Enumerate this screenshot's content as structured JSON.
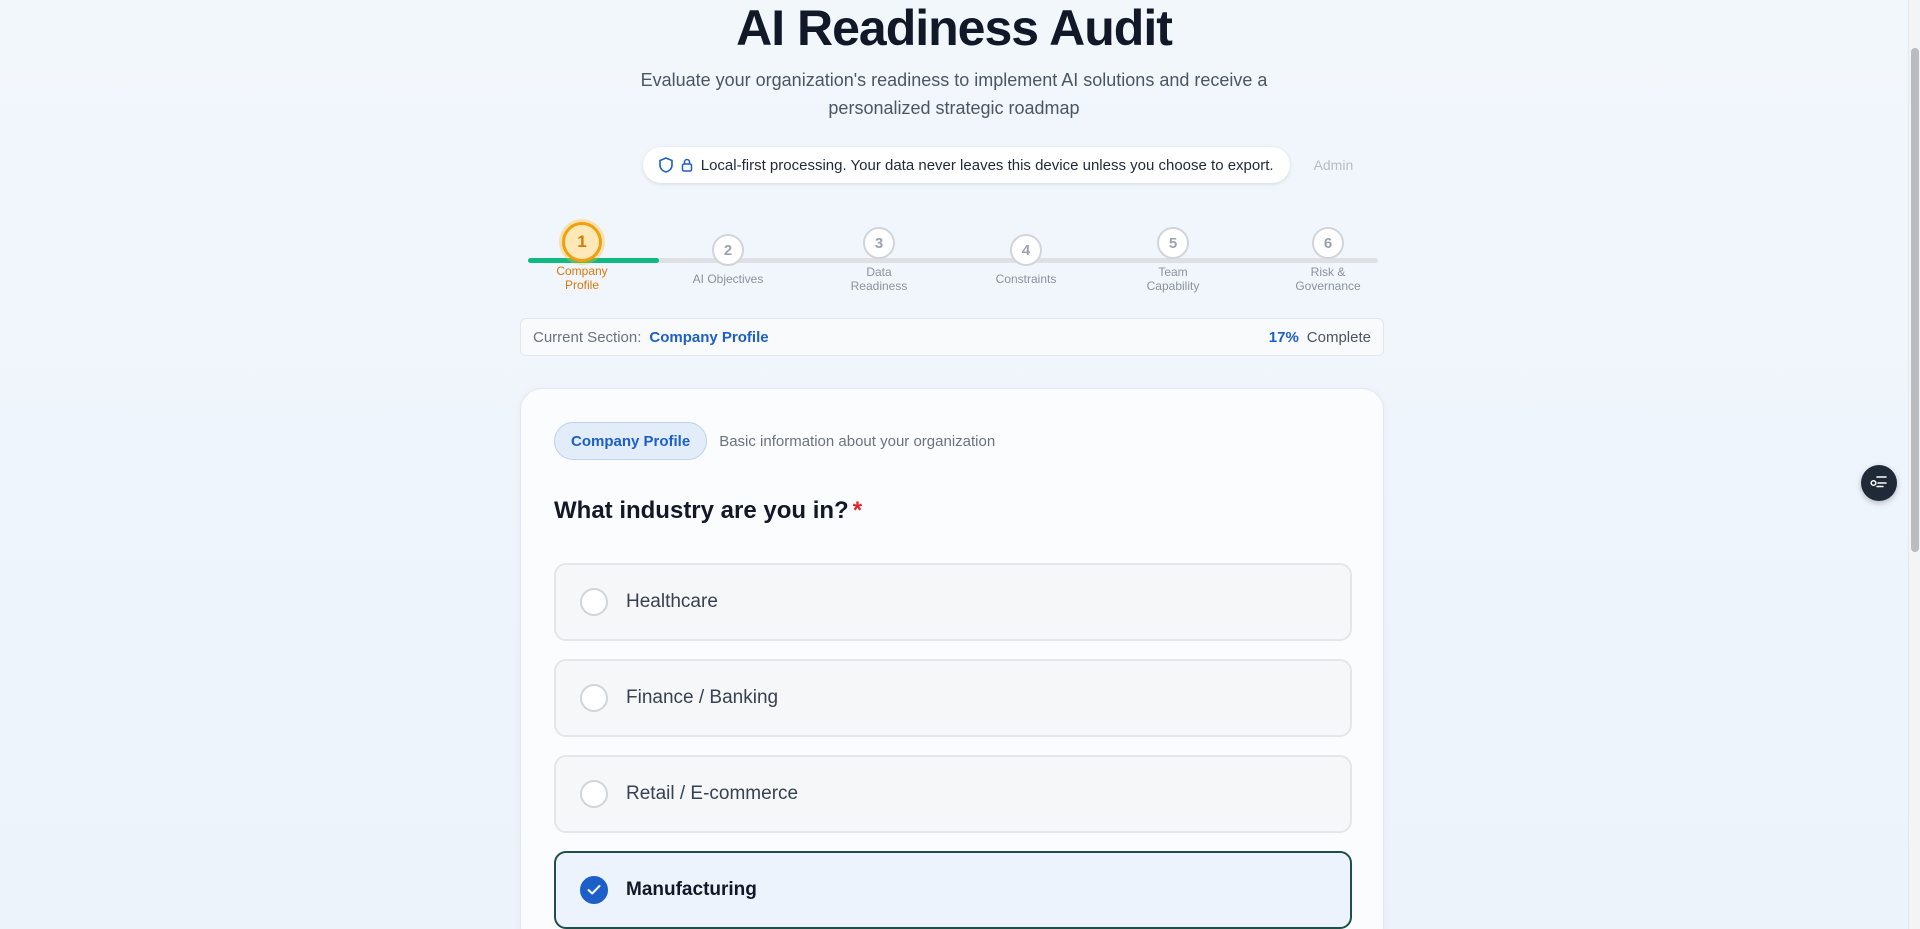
{
  "header": {
    "title": "AI Readiness Audit",
    "subtitle_line1": "Evaluate your organization's readiness to implement AI solutions and receive a",
    "subtitle_line2": "personalized strategic roadmap"
  },
  "privacy": {
    "text": "Local-first processing. Your data never leaves this device unless you choose to export.",
    "icons": [
      "shield-icon",
      "lock-icon"
    ],
    "admin_label": "Admin"
  },
  "stepper": {
    "progress_fraction": 0.154,
    "steps": [
      {
        "number": "1",
        "label_line1": "Company",
        "label_line2": "Profile",
        "active": true
      },
      {
        "number": "2",
        "label_line1": "AI Objectives",
        "label_line2": "",
        "active": false
      },
      {
        "number": "3",
        "label_line1": "Data",
        "label_line2": "Readiness",
        "active": false
      },
      {
        "number": "4",
        "label_line1": "Constraints",
        "label_line2": "",
        "active": false
      },
      {
        "number": "5",
        "label_line1": "Team",
        "label_line2": "Capability",
        "active": false
      },
      {
        "number": "6",
        "label_line1": "Risk &",
        "label_line2": "Governance",
        "active": false
      }
    ]
  },
  "section_bar": {
    "label": "Current Section:",
    "value": "Company Profile",
    "percent": "17%",
    "complete_label": "Complete"
  },
  "card": {
    "badge": "Company Profile",
    "badge_description": "Basic information about your organization",
    "question": "What industry are you in?",
    "required_marker": "*",
    "options": [
      {
        "label": "Healthcare",
        "selected": false
      },
      {
        "label": "Finance / Banking",
        "selected": false
      },
      {
        "label": "Retail / E-commerce",
        "selected": false
      },
      {
        "label": "Manufacturing",
        "selected": true
      }
    ]
  },
  "colors": {
    "accent_blue": "#1d5fc9",
    "progress_green": "#10b981",
    "active_step_orange": "#f59e0b",
    "required_red": "#dc2626"
  },
  "floating_button": {
    "icon": "toggle-list-icon"
  }
}
